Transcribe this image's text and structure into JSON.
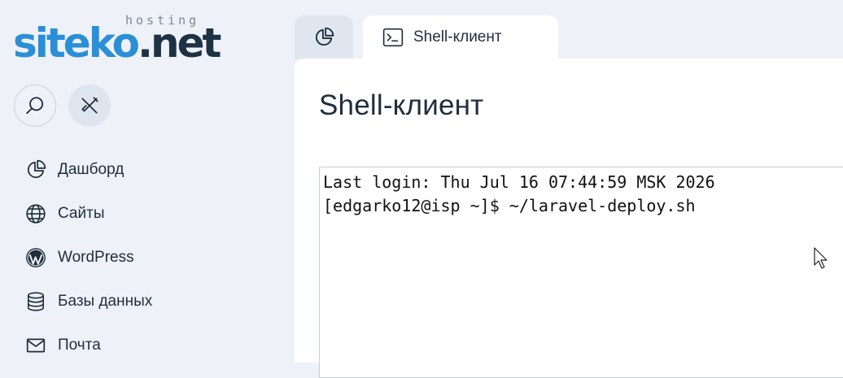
{
  "brand": {
    "logo_part1": "siteko",
    "logo_part2": ".net",
    "logo_sub": "hosting",
    "colors": {
      "primary": "#2a8fd6",
      "dark": "#1d3344"
    }
  },
  "sidebar": {
    "search_icon": "search-icon",
    "tools_icon": "tools-icon",
    "items": [
      {
        "label": "Дашборд",
        "icon": "pie-chart-icon"
      },
      {
        "label": "Сайты",
        "icon": "globe-icon"
      },
      {
        "label": "WordPress",
        "icon": "wordpress-icon"
      },
      {
        "label": "Базы данных",
        "icon": "database-icon"
      },
      {
        "label": "Почта",
        "icon": "mail-icon"
      }
    ]
  },
  "tabs": [
    {
      "label": "",
      "icon": "pie-chart-icon",
      "active": false
    },
    {
      "label": "Shell-клиент",
      "icon": "terminal-icon",
      "active": true
    }
  ],
  "main": {
    "title": "Shell-клиент",
    "terminal": {
      "lines": [
        "Last login: Thu Jul 16 07:44:59 MSK 2026",
        "[edgarko12@isp ~]$ ~/laravel-deploy.sh"
      ]
    }
  }
}
